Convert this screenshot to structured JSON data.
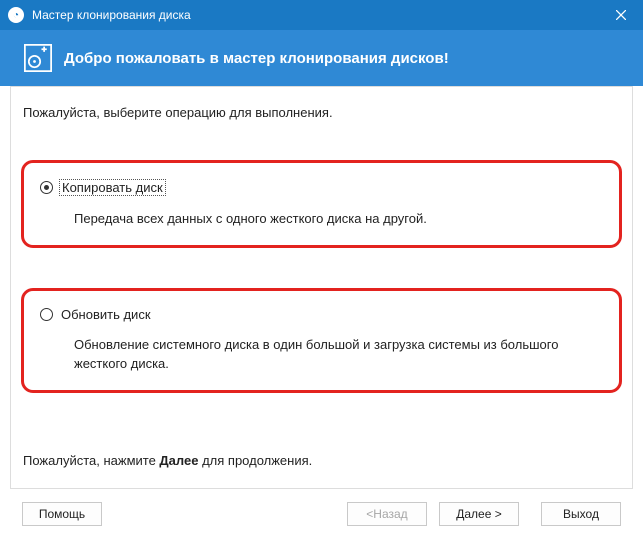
{
  "window": {
    "title": "Мастер клонирования диска"
  },
  "header": {
    "welcome": "Добро пожаловать в мастер клонирования дисков!"
  },
  "body": {
    "intro": "Пожалуйста, выберите операцию для выполнения.",
    "option1": {
      "label": "Копировать диск",
      "desc": "Передача всех данных с одного жесткого диска на другой.",
      "selected": true
    },
    "option2": {
      "label": "Обновить диск",
      "desc": "Обновление системного диска в один большой и загрузка системы из большого жесткого диска.",
      "selected": false
    },
    "continue_prefix": "Пожалуйста, нажмите ",
    "continue_bold": "Далее",
    "continue_suffix": " для продолжения."
  },
  "footer": {
    "help": "Помощь",
    "back": "<Назад",
    "next": "Далее >",
    "exit": "Выход"
  }
}
